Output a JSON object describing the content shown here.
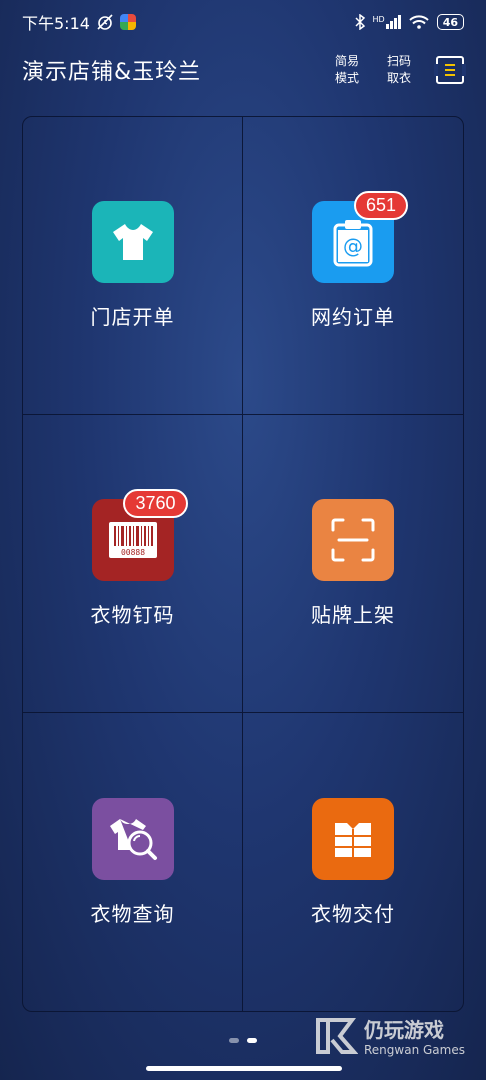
{
  "status": {
    "time": "下午5:14",
    "battery": "46",
    "network": "HD"
  },
  "header": {
    "store_name": "演示店铺&玉玲兰",
    "simple_mode": [
      "简易",
      "模式"
    ],
    "scan_pickup": [
      "扫码",
      "取衣"
    ]
  },
  "tiles": [
    {
      "label": "门店开单",
      "color": "#1bb5b8",
      "icon": "tshirt-icon",
      "badge": ""
    },
    {
      "label": "网约订单",
      "color": "#1a9cf0",
      "icon": "clipboard-at-icon",
      "badge": "651"
    },
    {
      "label": "衣物钉码",
      "color": "#a42424",
      "icon": "barcode-icon",
      "badge": "3760",
      "barcode_text": "00888"
    },
    {
      "label": "贴牌上架",
      "color": "#ea8442",
      "icon": "scan-frame-icon",
      "badge": ""
    },
    {
      "label": "衣物查询",
      "color": "#7b4fa0",
      "icon": "shirt-search-icon",
      "badge": ""
    },
    {
      "label": "衣物交付",
      "color": "#ea6a10",
      "icon": "folded-clothes-icon",
      "badge": ""
    }
  ],
  "pager": {
    "current": 2,
    "total": 2
  },
  "watermark": {
    "brand": "仍玩游戏",
    "sub": "Rengwan Games"
  }
}
